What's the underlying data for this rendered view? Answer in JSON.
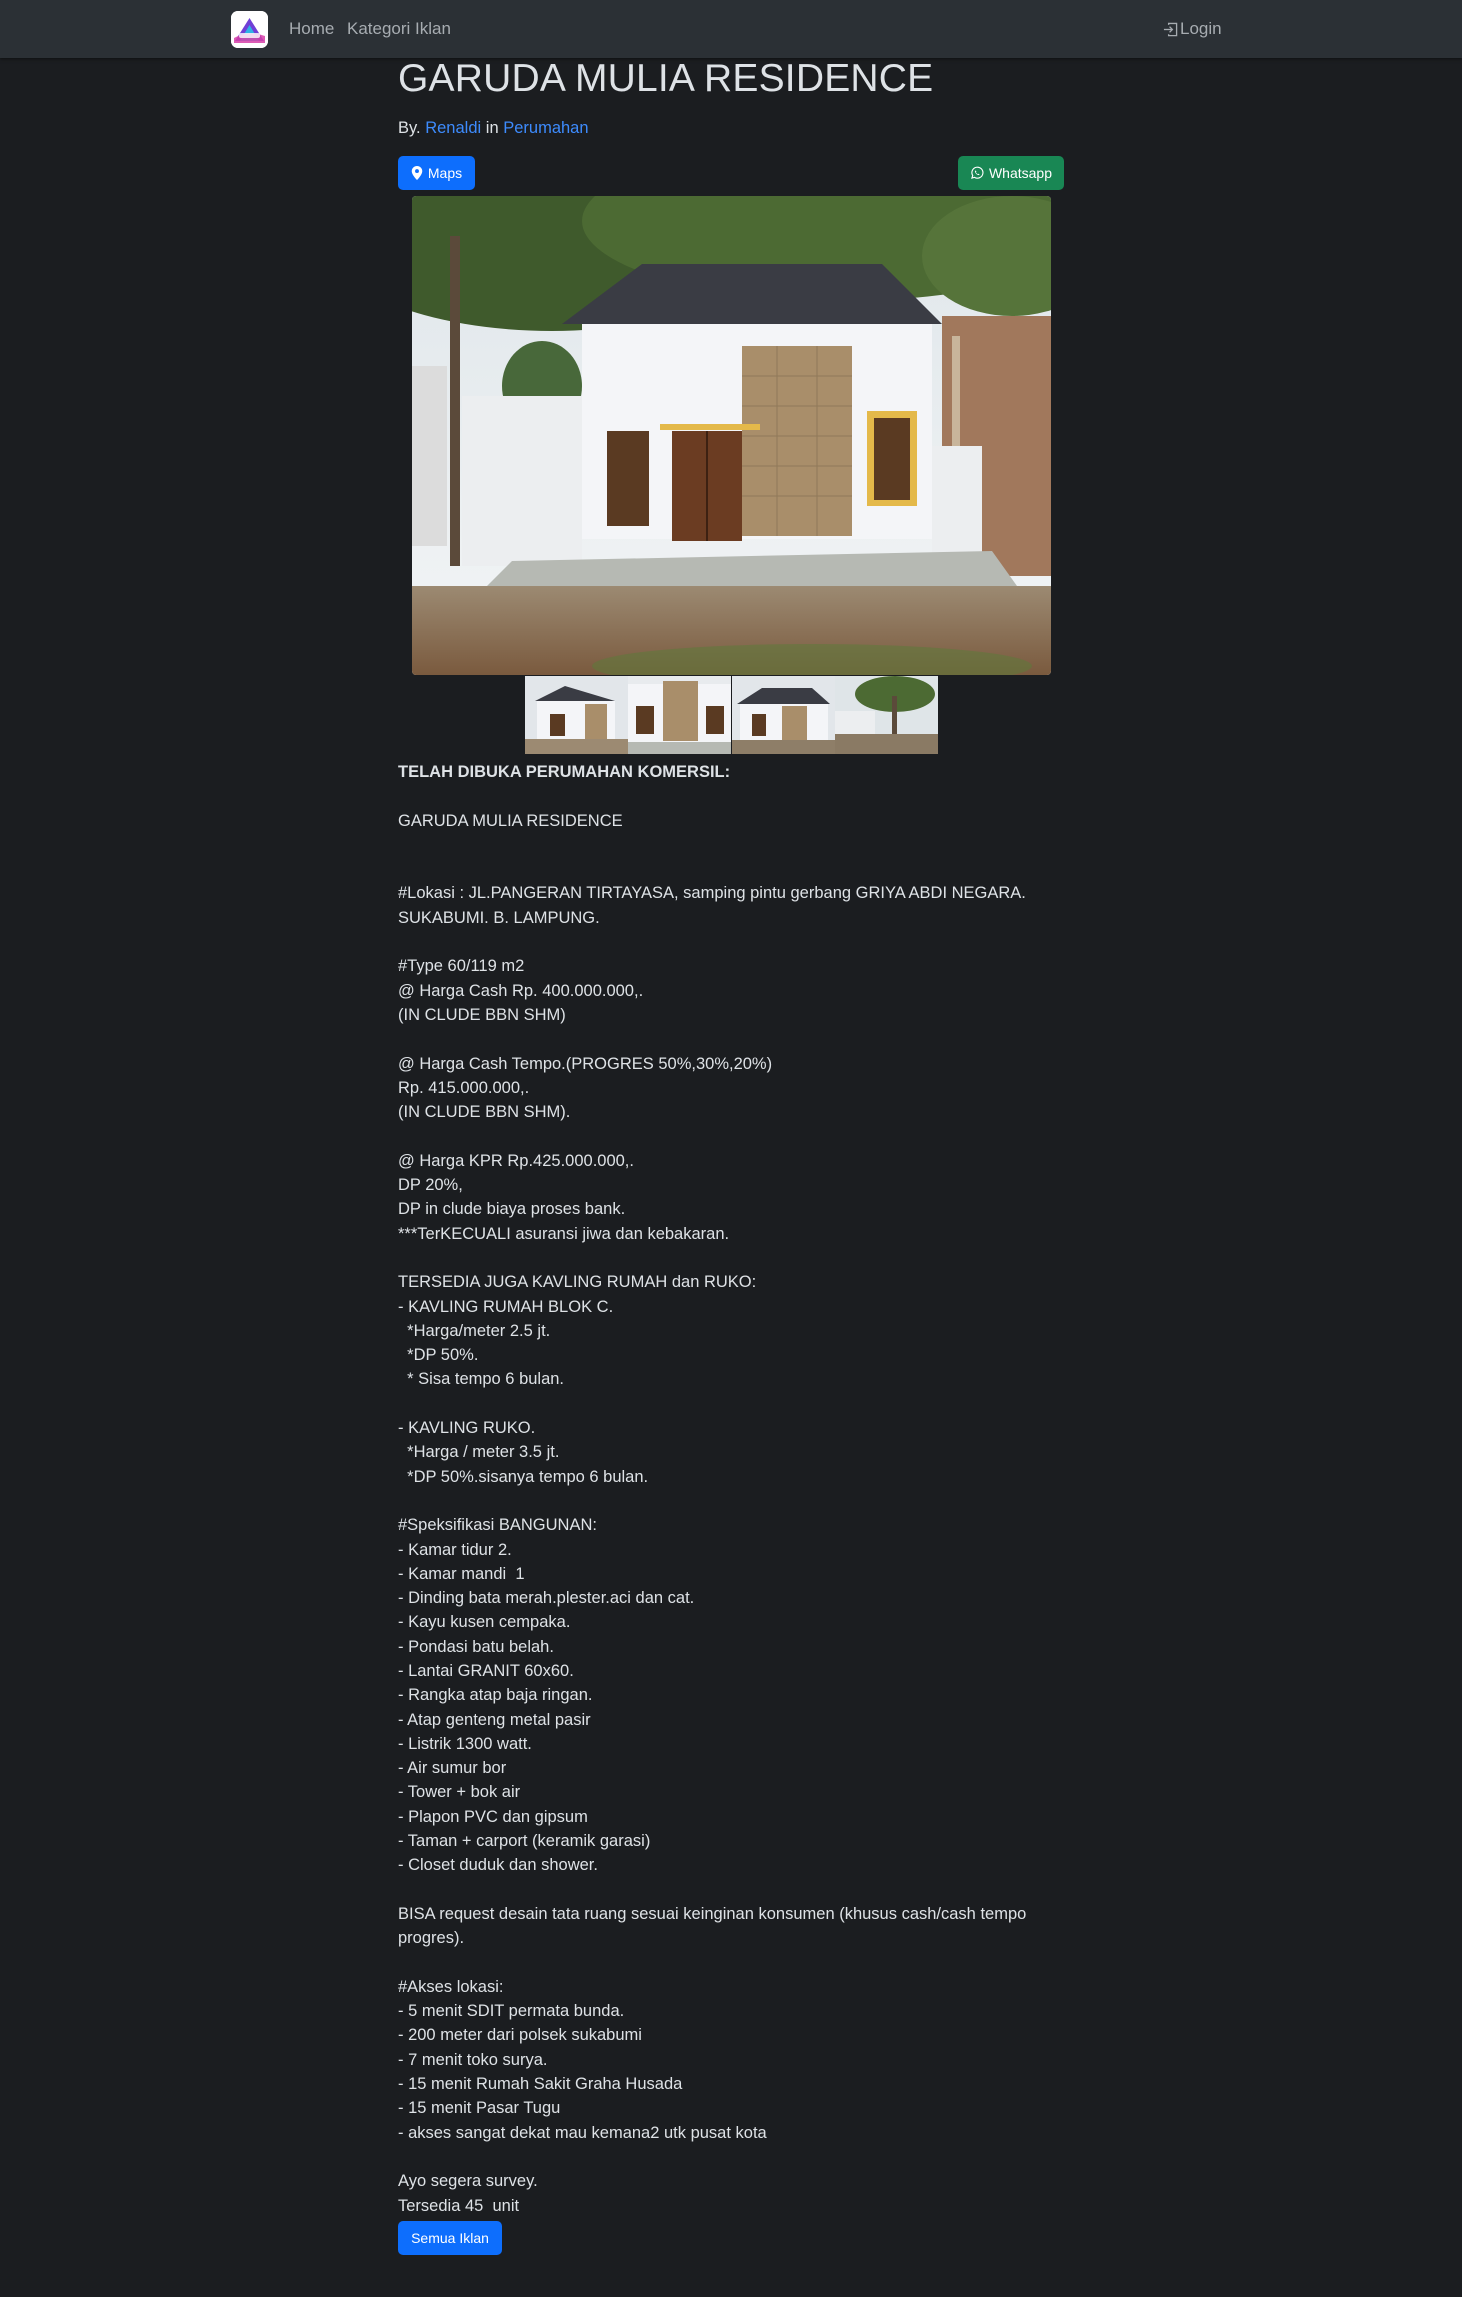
{
  "navbar": {
    "links": [
      "Home",
      "Kategori Iklan"
    ],
    "login_label": "Login",
    "login_icon": "box-arrow-in-right-icon"
  },
  "listing": {
    "title": "GARUDA MULIA RESIDENCE",
    "by_prefix": "By.",
    "author": "Renaldi",
    "in_word": "in",
    "category": "Perumahan",
    "maps_label": "Maps",
    "maps_icon": "geo-pin-icon",
    "whatsapp_label": "Whatsapp",
    "whatsapp_icon": "whatsapp-icon",
    "main_image": "house-photo",
    "thumbnails": [
      "house-photo-1",
      "house-photo-2",
      "house-photo-3",
      "house-photo-4"
    ],
    "all_ads_label": "Semua Iklan"
  },
  "description": {
    "lines": [
      "TELAH DIBUKA PERUMAHAN KOMERSIL:",
      "",
      "GARUDA MULIA RESIDENCE",
      "",
      "",
      "#Lokasi : JL.PANGERAN TIRTAYASA, samping pintu gerbang GRIYA ABDI NEGARA.",
      "SUKABUMI. B. LAMPUNG.",
      "",
      "#Type 60/119 m2",
      "@ Harga Cash Rp. 400.000.000,.",
      "(IN CLUDE BBN SHM)",
      "",
      "@ Harga Cash Tempo.(PROGRES 50%,30%,20%)",
      "Rp. 415.000.000,.",
      "(IN CLUDE BBN SHM).",
      "",
      "@ Harga KPR Rp.425.000.000,.",
      "DP 20%,",
      "DP in clude biaya proses bank.",
      "***TerKECUALI asuransi jiwa dan kebakaran.",
      "",
      "TERSEDIA JUGA KAVLING RUMAH dan RUKO:",
      "- KAVLING RUMAH BLOK C.",
      "  *Harga/meter 2.5 jt.",
      "  *DP 50%.",
      "  * Sisa tempo 6 bulan.",
      "",
      "- KAVLING RUKO.",
      "  *Harga / meter 3.5 jt.",
      "  *DP 50%.sisanya tempo 6 bulan.",
      "",
      "#Speksifikasi BANGUNAN:",
      "- Kamar tidur 2.",
      "- Kamar mandi  1",
      "- Dinding bata merah.plester.aci dan cat.",
      "- Kayu kusen cempaka.",
      "- Pondasi batu belah.",
      "- Lantai GRANIT 60x60.",
      "- Rangka atap baja ringan.",
      "- Atap genteng metal pasir",
      "- Listrik 1300 watt.",
      "- Air sumur bor",
      "- Tower + bok air",
      "- Plapon PVC dan gipsum",
      "- Taman + carport (keramik garasi)",
      "- Closet duduk dan shower.",
      "",
      "BISA request desain tata ruang sesuai keinginan konsumen (khusus cash/cash tempo",
      "progres).",
      "",
      "#Akses lokasi:",
      "- 5 menit SDIT permata bunda.",
      "- 200 meter dari polsek sukabumi",
      "- 7 menit toko surya.",
      "- 15 menit Rumah Sakit Graha Husada",
      "- 15 menit Pasar Tugu",
      "- akses sangat dekat mau kemana2 utk pusat kota",
      "",
      "Ayo segera survey.",
      "Tersedia 45  unit"
    ]
  },
  "colors": {
    "background": "#1b1d20",
    "navbar": "#2b3035",
    "link": "#3d8bfd",
    "primary_button": "#0d6efd",
    "success_button": "#198754"
  }
}
